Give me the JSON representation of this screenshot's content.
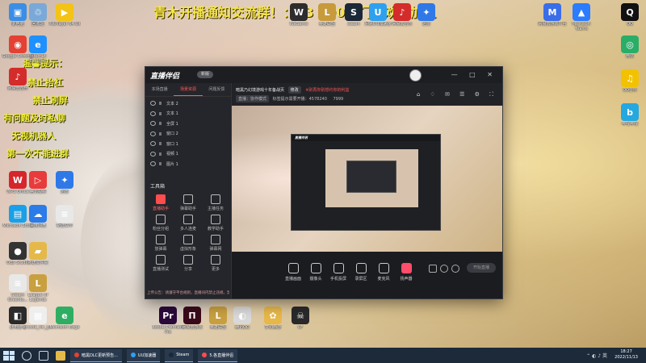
{
  "overlay": {
    "top_text": "青木开播通知交流群！：93 900 3门，欢迎加入",
    "side_notes": [
      "温馨提示：",
      "禁止抬杠",
      "禁止刷屏",
      "有问题及时私聊",
      "无视机器人",
      "第一次不能进群"
    ]
  },
  "desktop_icons_left": [
    {
      "label": "此电脑",
      "color": "#3a8ee6",
      "glyph": "▣"
    },
    {
      "label": "回收站",
      "color": "#7aa9d8",
      "glyph": "♲"
    },
    {
      "label": "PotPlayer 64 bit",
      "color": "#f3c316",
      "glyph": "▶"
    },
    {
      "label": "Google Chrome",
      "color": "#e34133",
      "glyph": "◉"
    },
    {
      "label": "Internet Explorer",
      "color": "#1e90ff",
      "glyph": "e"
    },
    {
      "label": "网易云音乐",
      "color": "#d42b2b",
      "glyph": "♪"
    },
    {
      "label": "WPS Office",
      "color": "#d6262b",
      "glyph": "W"
    },
    {
      "label": "腾讯视频",
      "color": "#e83b3b",
      "glyph": "▷"
    },
    {
      "label": "迅雷",
      "color": "#2f78e8",
      "glyph": "✦"
    },
    {
      "label": "Microsoft Store",
      "color": "#1aa0e8",
      "glyph": "▤"
    },
    {
      "label": "百度网盘",
      "color": "#2b7be8",
      "glyph": "☁"
    },
    {
      "label": "新建文本",
      "color": "#e8e8e8",
      "glyph": "≡"
    },
    {
      "label": "OBS Studio",
      "color": "#333333",
      "glyph": "●"
    },
    {
      "label": "新建文件夹",
      "color": "#e4b94a",
      "glyph": "▰"
    },
    {
      "label": "Steam Greenlu...",
      "color": "#e8e8e8",
      "glyph": "≡"
    },
    {
      "label": "League of Legends",
      "color": "#c8a040",
      "glyph": "L"
    },
    {
      "label": "此电脑 2",
      "color": "#2b2b2b",
      "glyph": "◧"
    },
    {
      "label": "qrcode_for_g...",
      "color": "#eeeeee",
      "glyph": "▦"
    },
    {
      "label": "Microsoft Edge",
      "color": "#2fae63",
      "glyph": "e"
    }
  ],
  "desktop_icons_top": [
    {
      "label": "WeGame",
      "color": "#2d2d2d",
      "glyph": "W"
    },
    {
      "label": "英雄联盟",
      "color": "#c79a3c",
      "glyph": "L"
    },
    {
      "label": "steam",
      "color": "#1b2838",
      "glyph": "S"
    },
    {
      "label": "网易UU加速器",
      "color": "#2ea0f0",
      "glyph": "U"
    },
    {
      "label": "网易云音乐",
      "color": "#d42b2b",
      "glyph": "♪"
    },
    {
      "label": "迅雷",
      "color": "#2f78e8",
      "glyph": "✦"
    },
    {
      "label": "网易云游戏平台",
      "color": "#3a6de8",
      "glyph": "M"
    },
    {
      "label": "Microsoft Teams",
      "color": "#2b7cff",
      "glyph": "▲"
    },
    {
      "label": "QQ",
      "color": "#111111",
      "glyph": "Q"
    }
  ],
  "desktop_icons_right": [
    {
      "label": "微信",
      "color": "#2aae67",
      "glyph": "◎"
    },
    {
      "label": "QQ音乐",
      "color": "#f2c200",
      "glyph": "♫"
    },
    {
      "label": "哔哩哔哩",
      "color": "#24a8e0",
      "glyph": "b"
    }
  ],
  "desktop_icons_bottom": [
    {
      "label": "Adobe Premiere Pro",
      "color": "#2a0a3a",
      "glyph": "Pr"
    },
    {
      "label": "网易云游戏",
      "color": "#3a0a1a",
      "glyph": "П"
    },
    {
      "label": "英雄联盟",
      "color": "#c8a040",
      "glyph": "L"
    },
    {
      "label": "腾讯QQ",
      "color": "#d9d9d9",
      "glyph": "◐"
    },
    {
      "label": "梦幻西游",
      "color": "#e8b84a",
      "glyph": "✿"
    },
    {
      "label": "CF",
      "color": "#2a2a2a",
      "glyph": "☠"
    }
  ],
  "app": {
    "title": "直播伴侣",
    "version": "新版",
    "tabs": [
      "本场直播",
      "场景资源",
      "问题反馈"
    ],
    "sources": [
      "文本 2",
      "文本 1",
      "全屏 1",
      "窗口 2",
      "窗口 1",
      "视频 1",
      "图片 1"
    ],
    "tools_title": "工具箱",
    "tools": [
      "直播助手",
      "弹幕助手",
      "主播任务",
      "粉丝分组",
      "多人连麦",
      "教学助手",
      "放弹幕",
      "虚拟形象",
      "弹幕网",
      "直播测试",
      "分享",
      "更多"
    ],
    "notice": "上传公告：请遵守平台规则，直播间内禁止违规，禁止引流",
    "room_title": "暗黑乃幻境游戏十年备战页",
    "room_chip": "修改",
    "room_warn": "※别再你别想约你的利益",
    "sub_chip": "直播：协作模式",
    "sub_text": "标签提示需要开播：4578240",
    "sub_count": "7999",
    "bottom_buttons": [
      "直播画面",
      "摄像头",
      "手机投屏",
      "录屏区",
      "麦克风",
      "扬声器"
    ],
    "start_label": "开始直播",
    "window_controls": "— □ ✕"
  },
  "preview": {
    "nested_title": "直播伴侣"
  },
  "taskbar": {
    "apps": [
      {
        "label": "暗黑DLC更新预告...",
        "color": "#e34133"
      },
      {
        "label": "UU加速器",
        "color": "#2ea0f0"
      },
      {
        "label": "Steam",
        "color": "#1b2838"
      },
      {
        "label": "5.各直播伴侣",
        "color": "#ff4d4d"
      }
    ],
    "time": "18:27",
    "date": "2022/11/13"
  }
}
